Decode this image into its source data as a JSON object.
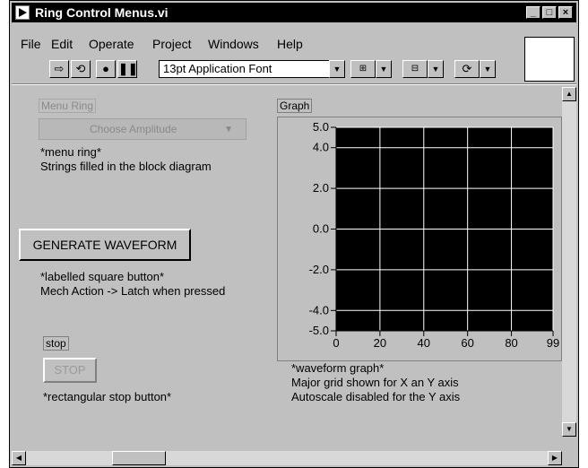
{
  "window": {
    "title": "Ring Control Menus.vi"
  },
  "menubar": {
    "items": [
      "File",
      "Edit",
      "Operate",
      "Project",
      "Windows",
      "Help"
    ]
  },
  "toolbar": {
    "font": "13pt Application Font"
  },
  "menu_ring": {
    "label": "Menu Ring",
    "value": "Choose Amplitude",
    "caption1": "*menu ring*",
    "caption2": "Strings filled in the block diagram"
  },
  "generate": {
    "label": "GENERATE WAVEFORM",
    "caption1": "*labelled square button*",
    "caption2": "Mech Action -> Latch when pressed"
  },
  "stop": {
    "label": "stop",
    "button": "STOP",
    "caption": "*rectangular stop button*"
  },
  "graph": {
    "label": "Graph",
    "caption1": "*waveform graph*",
    "caption2": "Major grid shown for X an Y axis",
    "caption3": "Autoscale disabled for the Y axis"
  },
  "chart_data": {
    "type": "line",
    "series": [],
    "xlim": [
      0,
      99
    ],
    "ylim": [
      -5.0,
      5.0
    ],
    "x_ticks": [
      "0",
      "20",
      "40",
      "60",
      "80",
      "99"
    ],
    "y_ticks": [
      "5.0",
      "4.0",
      "2.0",
      "0.0",
      "-2.0",
      "-4.0",
      "-5.0"
    ],
    "grid": true,
    "plot_background": "#000000",
    "grid_color": "#ffffff"
  }
}
